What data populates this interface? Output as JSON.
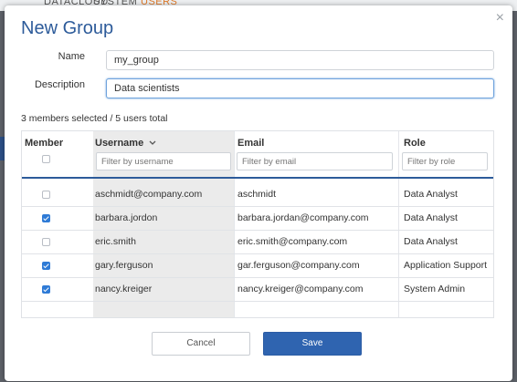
{
  "background": {
    "tabs": [
      "DATACLOUD",
      "SYSTEM",
      "USERS"
    ]
  },
  "dialog": {
    "title": "New Group",
    "close_glyph": "×",
    "name_label": "Name",
    "name_value": "my_group",
    "description_label": "Description",
    "description_value": "Data scientists",
    "selection_summary": "3 members selected / 5 users total"
  },
  "table": {
    "headers": {
      "member": "Member",
      "username": "Username",
      "username_sort_icon": "chevron-down-icon",
      "email": "Email",
      "role": "Role"
    },
    "filters": {
      "username_placeholder": "Filter by username",
      "email_placeholder": "Filter by email",
      "role_placeholder": "Filter by role"
    },
    "rows": [
      {
        "member": false,
        "username": "aschmidt@company.com",
        "email": "aschmidt",
        "role": "Data Analyst"
      },
      {
        "member": true,
        "username": "barbara.jordon",
        "email": "barbara.jordan@company.com",
        "role": "Data Analyst"
      },
      {
        "member": false,
        "username": "eric.smith",
        "email": "eric.smith@company.com",
        "role": "Data Analyst"
      },
      {
        "member": true,
        "username": "gary.ferguson",
        "email": "gar.ferguson@company.com",
        "role": "Application Support"
      },
      {
        "member": true,
        "username": "nancy.kreiger",
        "email": "nancy.kreiger@company.com",
        "role": "System Admin"
      }
    ]
  },
  "buttons": {
    "cancel": "Cancel",
    "save": "Save"
  },
  "colors": {
    "accent": "#2d5b9a",
    "checkbox_checked": "#2f7bd6",
    "save_button": "#2f64b0"
  }
}
